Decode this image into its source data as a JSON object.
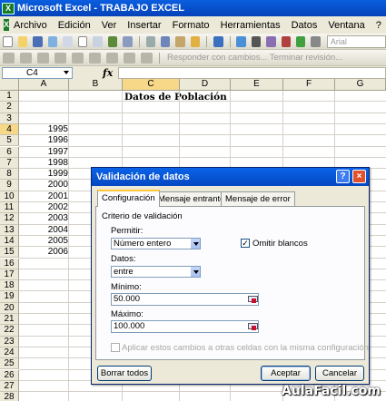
{
  "window": {
    "title": "Microsoft Excel - TRABAJO EXCEL",
    "app_icon": "excel-icon"
  },
  "menu": [
    "Archivo",
    "Edición",
    "Ver",
    "Insertar",
    "Formato",
    "Herramientas",
    "Datos",
    "Ventana",
    "?"
  ],
  "toolbar": {
    "font_name": "Arial",
    "review_text": "Responder con cambios...  Terminar revisión...",
    "accent": "#0a5fe0"
  },
  "formula_bar": {
    "cell_ref": "C4",
    "fx": "fx",
    "content": ""
  },
  "columns": [
    "A",
    "B",
    "C",
    "D",
    "E",
    "F",
    "G"
  ],
  "rows": [
    "1",
    "2",
    "3",
    "4",
    "5",
    "6",
    "7",
    "8",
    "9",
    "10",
    "11",
    "12",
    "13",
    "14",
    "15",
    "16",
    "17",
    "18",
    "19",
    "20",
    "21",
    "22",
    "23",
    "24",
    "25",
    "26",
    "27",
    "28"
  ],
  "cells": {
    "C1": "Datos de Población",
    "years": [
      "1995",
      "1996",
      "1997",
      "1998",
      "1999",
      "2000",
      "2001",
      "2002",
      "2003",
      "2004",
      "2005",
      "2006"
    ]
  },
  "dialog": {
    "title": "Validación de datos",
    "help": "?",
    "close": "×",
    "tabs": [
      "Configuración",
      "Mensaje entrante",
      "Mensaje de error"
    ],
    "active_tab": "Configuración",
    "section": "Criterio de validación",
    "permitir_label": "Permitir:",
    "permitir_value": "Número entero",
    "omitir_label": "Omitir blancos",
    "omitir_checked": true,
    "datos_label": "Datos:",
    "datos_value": "entre",
    "minimo_label": "Mínimo:",
    "minimo_value": "50.000",
    "maximo_label": "Máximo:",
    "maximo_value": "100.000",
    "apply_text": "Aplicar estos cambios a otras celdas con la misma configuración",
    "btn_clear": "Borrar todos",
    "btn_ok": "Aceptar",
    "btn_cancel": "Cancelar"
  },
  "watermark": "AulaFacil.com"
}
